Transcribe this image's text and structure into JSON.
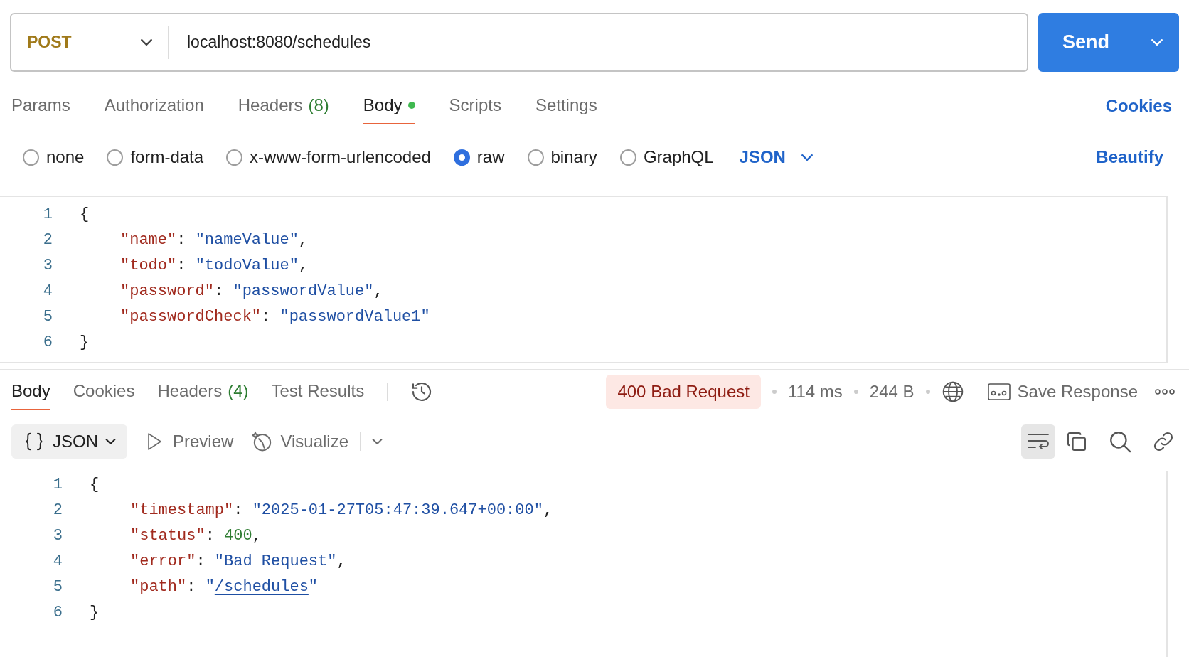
{
  "request": {
    "method": "POST",
    "url": "localhost:8080/schedules",
    "send_label": "Send"
  },
  "request_tabs": [
    {
      "label": "Params",
      "selected": false
    },
    {
      "label": "Authorization",
      "selected": false
    },
    {
      "label": "Headers",
      "count": "(8)",
      "selected": false
    },
    {
      "label": "Body",
      "selected": true,
      "modified": true
    },
    {
      "label": "Scripts",
      "selected": false
    },
    {
      "label": "Settings",
      "selected": false
    }
  ],
  "cookies_link": "Cookies",
  "body_types": [
    {
      "label": "none",
      "selected": false
    },
    {
      "label": "form-data",
      "selected": false
    },
    {
      "label": "x-www-form-urlencoded",
      "selected": false
    },
    {
      "label": "raw",
      "selected": true
    },
    {
      "label": "binary",
      "selected": false
    },
    {
      "label": "GraphQL",
      "selected": false
    }
  ],
  "raw_format": "JSON",
  "beautify_link": "Beautify",
  "request_body": [
    {
      "number": "1",
      "indented": false,
      "tokens": [
        {
          "kind": "punct",
          "text": "{"
        }
      ]
    },
    {
      "number": "2",
      "indented": true,
      "tokens": [
        {
          "kind": "key",
          "text": "\"name\""
        },
        {
          "kind": "punct",
          "text": ": "
        },
        {
          "kind": "string",
          "text": "\"nameValue\""
        },
        {
          "kind": "punct",
          "text": ","
        }
      ]
    },
    {
      "number": "3",
      "indented": true,
      "tokens": [
        {
          "kind": "key",
          "text": "\"todo\""
        },
        {
          "kind": "punct",
          "text": ": "
        },
        {
          "kind": "string",
          "text": "\"todoValue\""
        },
        {
          "kind": "punct",
          "text": ","
        }
      ]
    },
    {
      "number": "4",
      "indented": true,
      "tokens": [
        {
          "kind": "key",
          "text": "\"password\""
        },
        {
          "kind": "punct",
          "text": ": "
        },
        {
          "kind": "string",
          "text": "\"passwordValue\""
        },
        {
          "kind": "punct",
          "text": ","
        }
      ]
    },
    {
      "number": "5",
      "indented": true,
      "tokens": [
        {
          "kind": "key",
          "text": "\"passwordCheck\""
        },
        {
          "kind": "punct",
          "text": ": "
        },
        {
          "kind": "string",
          "text": "\"passwordValue1\""
        }
      ]
    },
    {
      "number": "6",
      "indented": false,
      "tokens": [
        {
          "kind": "punct",
          "text": "}"
        }
      ]
    }
  ],
  "response_tabs": [
    {
      "label": "Body",
      "selected": true
    },
    {
      "label": "Cookies",
      "selected": false
    },
    {
      "label": "Headers",
      "count": "(4)",
      "selected": false
    },
    {
      "label": "Test Results",
      "selected": false
    }
  ],
  "response_status": {
    "status": "400 Bad Request",
    "time": "114 ms",
    "size": "244 B",
    "save_label": "Save Response"
  },
  "response_toolbar": {
    "format": "JSON",
    "preview": "Preview",
    "visualize": "Visualize",
    "wrap_selected": true
  },
  "response_body": [
    {
      "number": "1",
      "indented": false,
      "tokens": [
        {
          "kind": "punct",
          "text": "{"
        }
      ]
    },
    {
      "number": "2",
      "indented": true,
      "tokens": [
        {
          "kind": "key",
          "text": "\"timestamp\""
        },
        {
          "kind": "punct",
          "text": ": "
        },
        {
          "kind": "string",
          "text": "\"2025-01-27T05:47:39.647+00:00\""
        },
        {
          "kind": "punct",
          "text": ","
        }
      ]
    },
    {
      "number": "3",
      "indented": true,
      "tokens": [
        {
          "kind": "key",
          "text": "\"status\""
        },
        {
          "kind": "punct",
          "text": ": "
        },
        {
          "kind": "number",
          "text": "400"
        },
        {
          "kind": "punct",
          "text": ","
        }
      ]
    },
    {
      "number": "4",
      "indented": true,
      "tokens": [
        {
          "kind": "key",
          "text": "\"error\""
        },
        {
          "kind": "punct",
          "text": ": "
        },
        {
          "kind": "string",
          "text": "\"Bad Request\""
        },
        {
          "kind": "punct",
          "text": ","
        }
      ]
    },
    {
      "number": "5",
      "indented": true,
      "tokens": [
        {
          "kind": "key",
          "text": "\"path\""
        },
        {
          "kind": "punct",
          "text": ": "
        },
        {
          "kind": "string",
          "text": "\""
        },
        {
          "kind": "link",
          "text": "/schedules"
        },
        {
          "kind": "string",
          "text": "\""
        }
      ]
    },
    {
      "number": "6",
      "indented": false,
      "tokens": [
        {
          "kind": "punct",
          "text": "}"
        }
      ]
    }
  ]
}
